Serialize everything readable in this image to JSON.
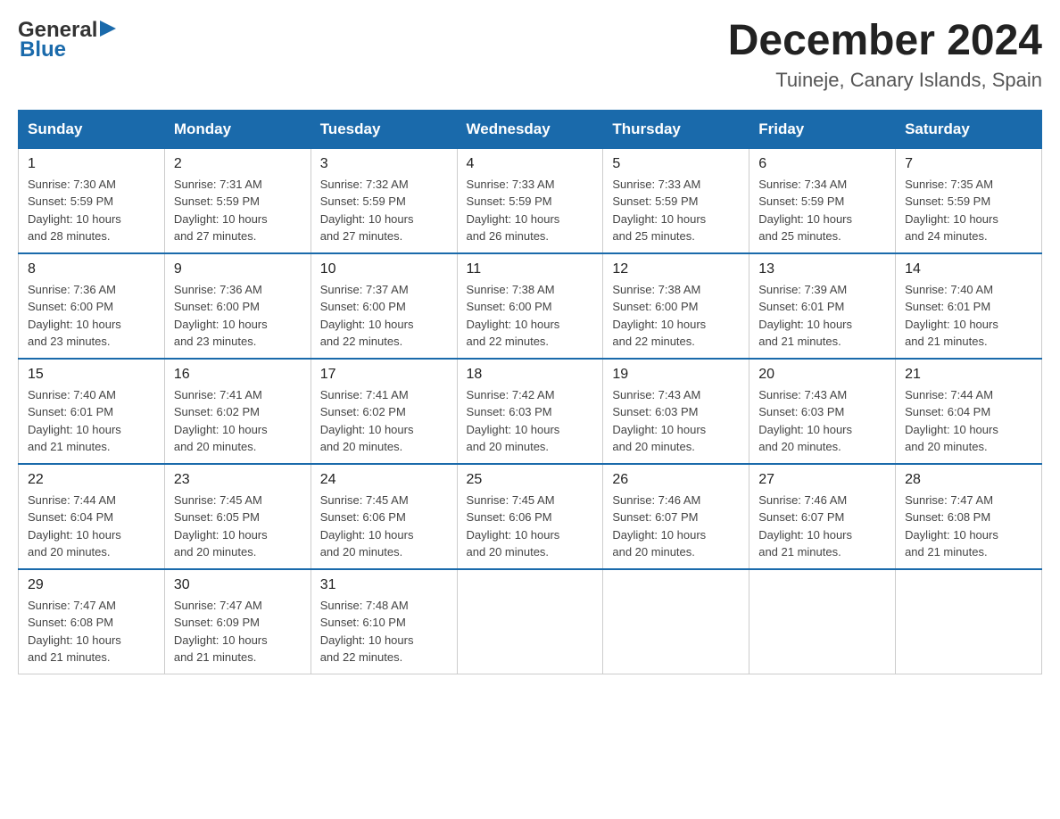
{
  "logo": {
    "general": "General",
    "blue": "Blue"
  },
  "header": {
    "month": "December 2024",
    "location": "Tuineje, Canary Islands, Spain"
  },
  "weekdays": [
    "Sunday",
    "Monday",
    "Tuesday",
    "Wednesday",
    "Thursday",
    "Friday",
    "Saturday"
  ],
  "weeks": [
    [
      {
        "day": 1,
        "sunrise": "7:30 AM",
        "sunset": "5:59 PM",
        "daylight": "10 hours and 28 minutes."
      },
      {
        "day": 2,
        "sunrise": "7:31 AM",
        "sunset": "5:59 PM",
        "daylight": "10 hours and 27 minutes."
      },
      {
        "day": 3,
        "sunrise": "7:32 AM",
        "sunset": "5:59 PM",
        "daylight": "10 hours and 27 minutes."
      },
      {
        "day": 4,
        "sunrise": "7:33 AM",
        "sunset": "5:59 PM",
        "daylight": "10 hours and 26 minutes."
      },
      {
        "day": 5,
        "sunrise": "7:33 AM",
        "sunset": "5:59 PM",
        "daylight": "10 hours and 25 minutes."
      },
      {
        "day": 6,
        "sunrise": "7:34 AM",
        "sunset": "5:59 PM",
        "daylight": "10 hours and 25 minutes."
      },
      {
        "day": 7,
        "sunrise": "7:35 AM",
        "sunset": "5:59 PM",
        "daylight": "10 hours and 24 minutes."
      }
    ],
    [
      {
        "day": 8,
        "sunrise": "7:36 AM",
        "sunset": "6:00 PM",
        "daylight": "10 hours and 23 minutes."
      },
      {
        "day": 9,
        "sunrise": "7:36 AM",
        "sunset": "6:00 PM",
        "daylight": "10 hours and 23 minutes."
      },
      {
        "day": 10,
        "sunrise": "7:37 AM",
        "sunset": "6:00 PM",
        "daylight": "10 hours and 22 minutes."
      },
      {
        "day": 11,
        "sunrise": "7:38 AM",
        "sunset": "6:00 PM",
        "daylight": "10 hours and 22 minutes."
      },
      {
        "day": 12,
        "sunrise": "7:38 AM",
        "sunset": "6:00 PM",
        "daylight": "10 hours and 22 minutes."
      },
      {
        "day": 13,
        "sunrise": "7:39 AM",
        "sunset": "6:01 PM",
        "daylight": "10 hours and 21 minutes."
      },
      {
        "day": 14,
        "sunrise": "7:40 AM",
        "sunset": "6:01 PM",
        "daylight": "10 hours and 21 minutes."
      }
    ],
    [
      {
        "day": 15,
        "sunrise": "7:40 AM",
        "sunset": "6:01 PM",
        "daylight": "10 hours and 21 minutes."
      },
      {
        "day": 16,
        "sunrise": "7:41 AM",
        "sunset": "6:02 PM",
        "daylight": "10 hours and 20 minutes."
      },
      {
        "day": 17,
        "sunrise": "7:41 AM",
        "sunset": "6:02 PM",
        "daylight": "10 hours and 20 minutes."
      },
      {
        "day": 18,
        "sunrise": "7:42 AM",
        "sunset": "6:03 PM",
        "daylight": "10 hours and 20 minutes."
      },
      {
        "day": 19,
        "sunrise": "7:43 AM",
        "sunset": "6:03 PM",
        "daylight": "10 hours and 20 minutes."
      },
      {
        "day": 20,
        "sunrise": "7:43 AM",
        "sunset": "6:03 PM",
        "daylight": "10 hours and 20 minutes."
      },
      {
        "day": 21,
        "sunrise": "7:44 AM",
        "sunset": "6:04 PM",
        "daylight": "10 hours and 20 minutes."
      }
    ],
    [
      {
        "day": 22,
        "sunrise": "7:44 AM",
        "sunset": "6:04 PM",
        "daylight": "10 hours and 20 minutes."
      },
      {
        "day": 23,
        "sunrise": "7:45 AM",
        "sunset": "6:05 PM",
        "daylight": "10 hours and 20 minutes."
      },
      {
        "day": 24,
        "sunrise": "7:45 AM",
        "sunset": "6:06 PM",
        "daylight": "10 hours and 20 minutes."
      },
      {
        "day": 25,
        "sunrise": "7:45 AM",
        "sunset": "6:06 PM",
        "daylight": "10 hours and 20 minutes."
      },
      {
        "day": 26,
        "sunrise": "7:46 AM",
        "sunset": "6:07 PM",
        "daylight": "10 hours and 20 minutes."
      },
      {
        "day": 27,
        "sunrise": "7:46 AM",
        "sunset": "6:07 PM",
        "daylight": "10 hours and 21 minutes."
      },
      {
        "day": 28,
        "sunrise": "7:47 AM",
        "sunset": "6:08 PM",
        "daylight": "10 hours and 21 minutes."
      }
    ],
    [
      {
        "day": 29,
        "sunrise": "7:47 AM",
        "sunset": "6:08 PM",
        "daylight": "10 hours and 21 minutes."
      },
      {
        "day": 30,
        "sunrise": "7:47 AM",
        "sunset": "6:09 PM",
        "daylight": "10 hours and 21 minutes."
      },
      {
        "day": 31,
        "sunrise": "7:48 AM",
        "sunset": "6:10 PM",
        "daylight": "10 hours and 22 minutes."
      },
      null,
      null,
      null,
      null
    ]
  ],
  "labels": {
    "sunrise": "Sunrise:",
    "sunset": "Sunset:",
    "daylight": "Daylight:"
  }
}
